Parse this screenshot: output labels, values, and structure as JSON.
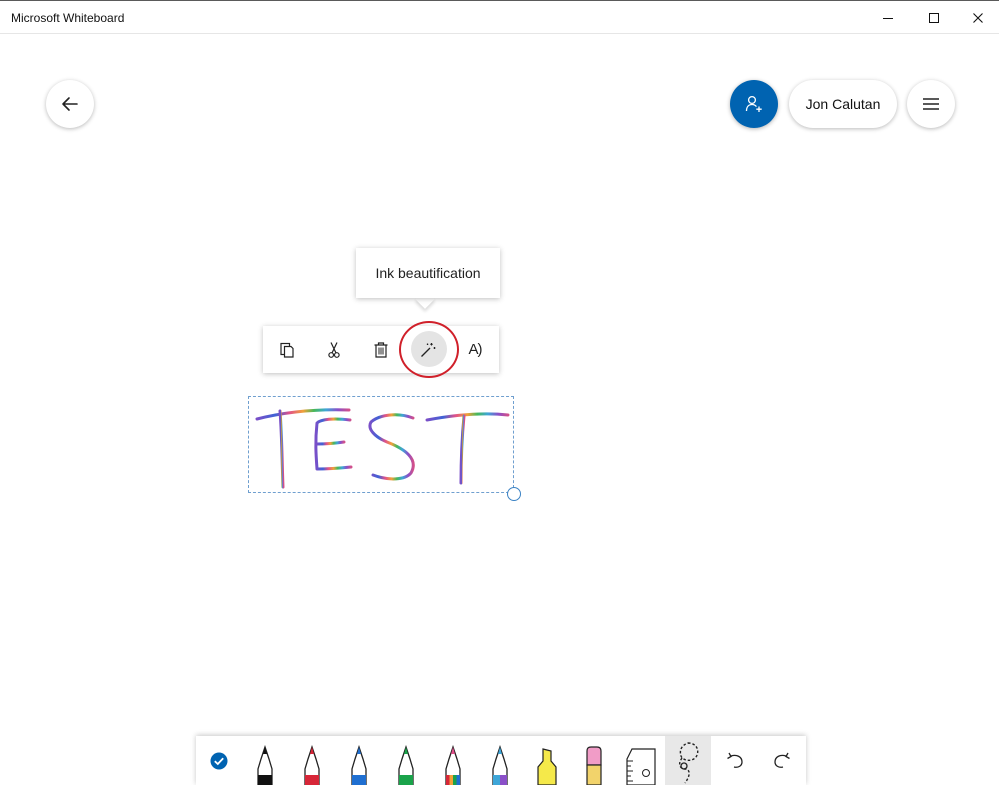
{
  "window": {
    "title": "Microsoft Whiteboard"
  },
  "header": {
    "user_name": "Jon Calutan",
    "accent_color": "#0063b1"
  },
  "selection_menu": {
    "tooltip": "Ink beautification",
    "text_to_speech_label": "A)",
    "items": [
      "copy-icon",
      "cut-icon",
      "delete-icon",
      "ink-beautification-icon",
      "read-aloud-icon"
    ],
    "highlighted": "ink-beautification"
  },
  "canvas": {
    "ink_text": "TEST"
  },
  "toolbar": {
    "tools": [
      "done",
      "black-pen",
      "red-pen",
      "blue-pen",
      "green-pen",
      "rainbow-pen",
      "galaxy-pen",
      "highlighter",
      "eraser",
      "ruler",
      "lasso-select",
      "undo",
      "redo"
    ],
    "selected_tool": "lasso-select",
    "pen_colors": {
      "black": "#111111",
      "red": "#d72638",
      "blue": "#1f6fd1",
      "green": "#1aa34a",
      "highlighter": "#f5e94a",
      "eraser": "#f19cc7"
    }
  }
}
